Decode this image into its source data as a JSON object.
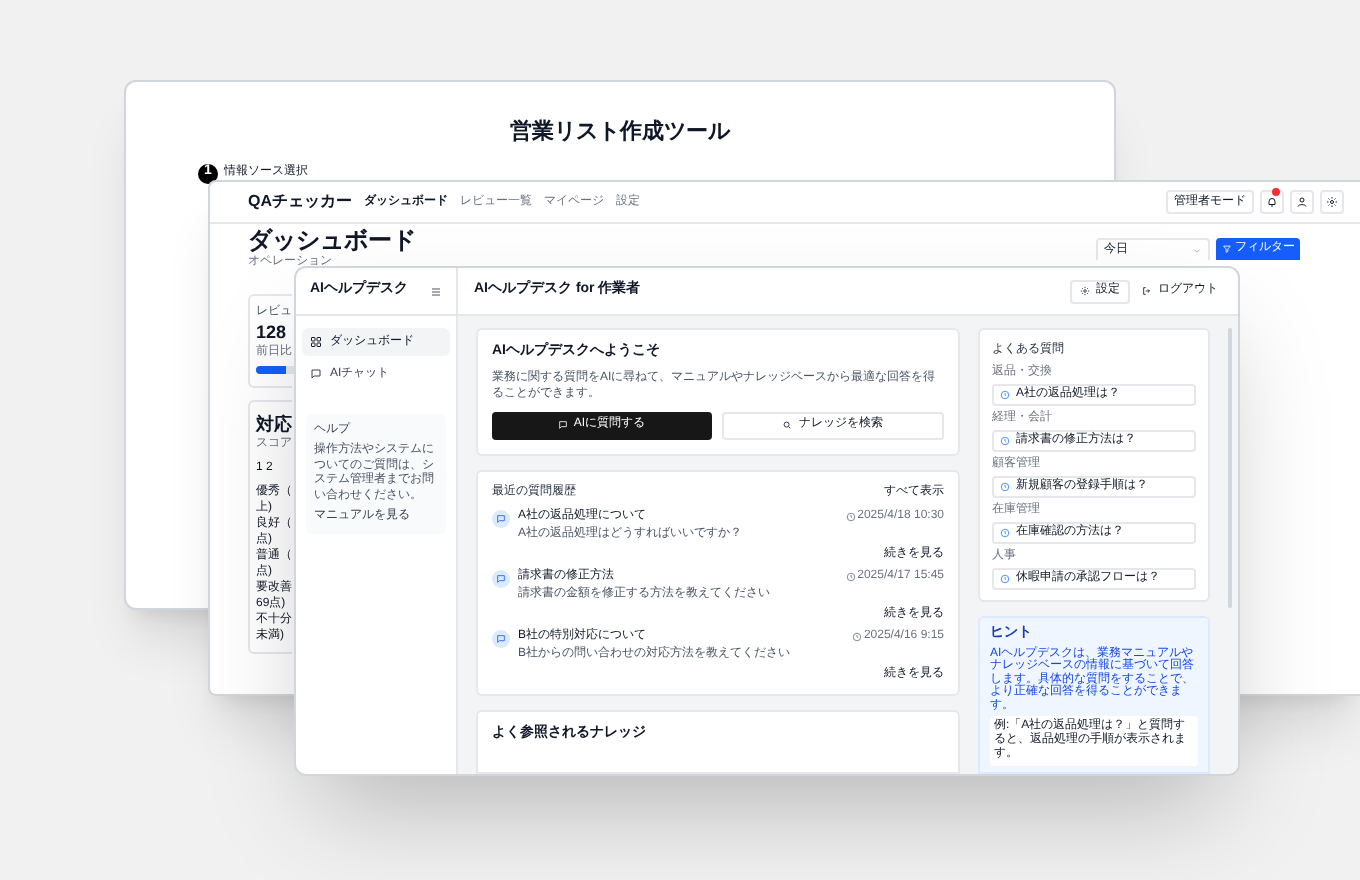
{
  "back_window": {
    "title": "営業リスト作成ツール",
    "step": {
      "number": "1",
      "label": "情報ソース選択"
    }
  },
  "middle_window": {
    "app_name": "QAチェッカー",
    "nav": [
      {
        "label": "ダッシュボード",
        "selected": true
      },
      {
        "label": "レビュー一覧",
        "selected": false
      },
      {
        "label": "マイページ",
        "selected": false
      },
      {
        "label": "設定",
        "selected": false
      }
    ],
    "admin_button": "管理者モード",
    "page_title": "ダッシュボード",
    "subtitle": "オペレーション",
    "period": "今日",
    "filter_button": "フィルター",
    "stat_card": {
      "label": "レビュ",
      "value": "128",
      "note": "前日比",
      "level": 0.8
    },
    "score_card": {
      "title": "対応",
      "subtitle": "スコア",
      "pages": "1 2",
      "lines": [
        "優秀（",
        "上)",
        "良好（",
        "点)",
        "普通（",
        "点)",
        "要改善",
        "69点)",
        "不十分",
        "未満)"
      ]
    }
  },
  "front_window": {
    "app_name": "AIヘルプデスク",
    "header_title": "AIヘルプデスク for 作業者",
    "settings_button": "設定",
    "logout_button": "ログアウト",
    "sidebar": [
      {
        "label": "ダッシュボード",
        "kind": "grid",
        "selected": true
      },
      {
        "label": "AIチャット",
        "kind": "chat",
        "selected": false
      }
    ],
    "help": {
      "title": "ヘルプ",
      "text": "操作方法やシステムについてのご質問は、システム管理者までお問い合わせください。",
      "link": "マニュアルを見る"
    },
    "welcome": {
      "title": "AIヘルプデスクへようこそ",
      "text": "業務に関する質問をAIに尋ねて、マニュアルやナレッジベースから最適な回答を得ることができます。",
      "ask_button": "AIに質問する",
      "search_button": "ナレッジを検索"
    },
    "history": {
      "title": "最近の質問履歴",
      "show_all": "すべて表示",
      "items": [
        {
          "title": "A社の返品処理について",
          "time": "2025/4/18 10:30",
          "text": "A社の返品処理はどうすればいいですか？",
          "more": "続きを見る"
        },
        {
          "title": "請求書の修正方法",
          "time": "2025/4/17 15:45",
          "text": "請求書の金額を修正する方法を教えてください",
          "more": "続きを見る"
        },
        {
          "title": "B社の特別対応について",
          "time": "2025/4/16 9:15",
          "text": "B社からの問い合わせの対応方法を教えてください",
          "more": "続きを見る"
        }
      ]
    },
    "knowledge": {
      "title": "よく参照されるナレッジ"
    },
    "faq": {
      "title": "よくある質問",
      "groups": [
        {
          "category": "返品・交換",
          "question": "A社の返品処理は？"
        },
        {
          "category": "経理・会計",
          "question": "請求書の修正方法は？"
        },
        {
          "category": "顧客管理",
          "question": "新規顧客の登録手順は？"
        },
        {
          "category": "在庫管理",
          "question": "在庫確認の方法は？"
        },
        {
          "category": "人事",
          "question": "休暇申請の承認フローは？"
        }
      ]
    },
    "hint": {
      "title": "ヒント",
      "text": "AIヘルプデスクは、業務マニュアルやナレッジベースの情報に基づいて回答します。具体的な質問をすることで、より正確な回答を得ることができます。",
      "example": "例:「A社の返品処理は？」と質問すると、返品処理の手順が表示されます。"
    }
  }
}
